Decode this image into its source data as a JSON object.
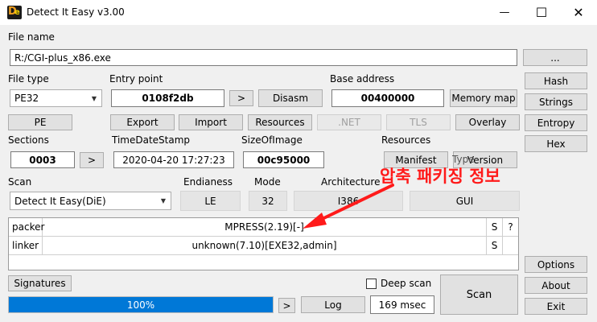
{
  "window": {
    "title": "Detect It Easy v3.00",
    "minimize_icon": "minimize-icon",
    "maximize_icon": "maximize-icon",
    "close_icon": "close-icon",
    "minimize_glyph": "—",
    "maximize_glyph": "☐",
    "close_glyph": "✕"
  },
  "file_name": {
    "label": "File name",
    "value": "R:/CGI-plus_x86.exe",
    "browse_label": "..."
  },
  "file_type": {
    "label": "File type",
    "value": "PE32"
  },
  "entry_point": {
    "label": "Entry point",
    "value": "0108f2db",
    "go_label": ">",
    "disasm_label": "Disasm"
  },
  "base_address": {
    "label": "Base address",
    "value": "00400000",
    "memory_map_label": "Memory map"
  },
  "right_buttons": {
    "hash": "Hash",
    "strings": "Strings",
    "entropy": "Entropy",
    "hex": "Hex",
    "options": "Options",
    "about": "About",
    "exit": "Exit"
  },
  "toolbar": {
    "pe": "PE",
    "export": "Export",
    "import": "Import",
    "resources": "Resources",
    "net": ".NET",
    "tls": "TLS",
    "overlay": "Overlay"
  },
  "sections": {
    "label": "Sections",
    "value": "0003",
    "go_label": ">"
  },
  "timedatestamp": {
    "label": "TimeDateStamp",
    "value": "2020-04-20 17:27:23"
  },
  "sizeofimage": {
    "label": "SizeOfImage",
    "value": "00c95000"
  },
  "resources": {
    "label": "Resources",
    "manifest_label": "Manifest",
    "version_label": "Version"
  },
  "scan_info": {
    "scan_label": "Scan",
    "scan_value": "Detect It Easy(DiE)",
    "endianness_label": "Endianess",
    "endianness_value": "LE",
    "mode_label": "Mode",
    "mode_value": "32",
    "architecture_label": "Architecture",
    "architecture_value": "I386",
    "type_label": "Type",
    "type_value": "GUI"
  },
  "results": [
    {
      "type": "packer",
      "value": "MPRESS(2.19)[-]",
      "s": "S",
      "q": "?"
    },
    {
      "type": "linker",
      "value": "unknown(7.10)[EXE32,admin]",
      "s": "S",
      "q": ""
    }
  ],
  "bottom": {
    "signatures_label": "Signatures",
    "deep_scan_label": "Deep scan",
    "scan_label": "Scan",
    "progress_text": "100%",
    "progress": 1.0,
    "go_label": ">",
    "log_label": "Log",
    "time_value": "169 msec"
  },
  "annotation": {
    "text": "압축 패키징 정보",
    "color": "#ff1a1a"
  }
}
